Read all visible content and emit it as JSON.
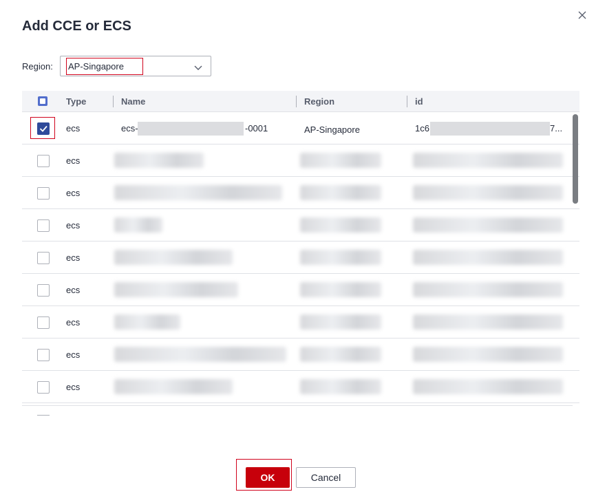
{
  "dialog": {
    "title": "Add CCE or ECS",
    "close_icon": "close-icon"
  },
  "region_filter": {
    "label": "Region:",
    "selected": "AP-Singapore",
    "chevron_icon": "chevron-down-icon"
  },
  "table": {
    "columns": [
      "Type",
      "Name",
      "Region",
      "id"
    ],
    "header_checkbox_state": "partial",
    "rows": [
      {
        "type": "ecs",
        "name_prefix": "ecs-",
        "name_suffix": "-0001",
        "region": "AP-Singapore",
        "id_prefix": "1c6",
        "id_suffix": "7...",
        "checked": true
      },
      {
        "type": "ecs",
        "checked": false
      },
      {
        "type": "ecs",
        "checked": false
      },
      {
        "type": "ecs",
        "checked": false
      },
      {
        "type": "ecs",
        "checked": false
      },
      {
        "type": "ecs",
        "checked": false
      },
      {
        "type": "ecs",
        "checked": false
      },
      {
        "type": "ecs",
        "checked": false
      },
      {
        "type": "ecs",
        "checked": false
      }
    ]
  },
  "footer": {
    "ok_label": "OK",
    "cancel_label": "Cancel"
  },
  "colors": {
    "primary": "#c7000b",
    "checkbox": "#526ecc",
    "highlight": "#d0021b"
  }
}
